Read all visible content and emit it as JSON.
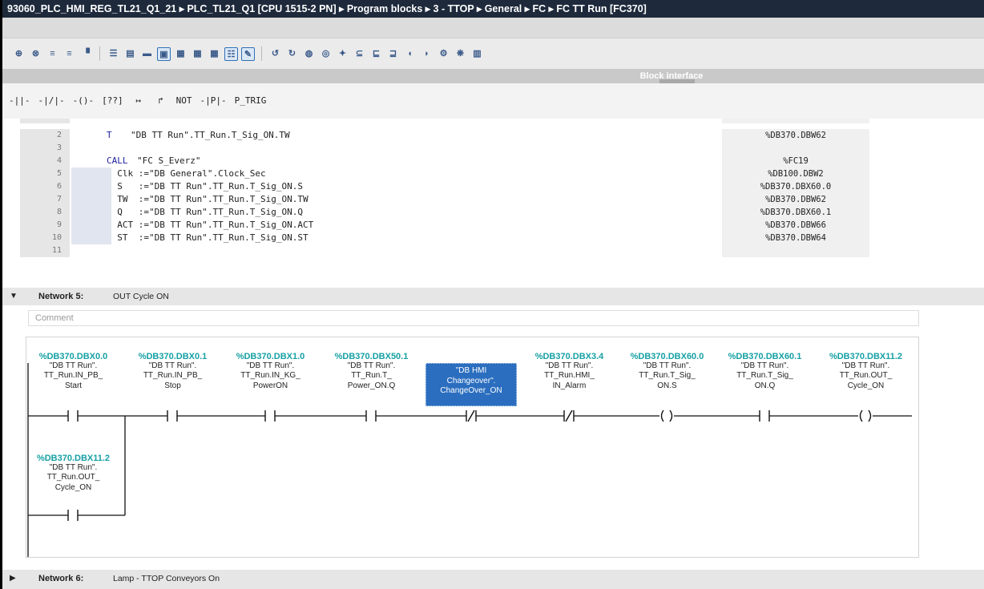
{
  "window": {
    "title": "93060_PLC_HMI_REG_TL21_Q1_21 ▸ PLC_TL21_Q1 [CPU 1515-2 PN] ▸ Program blocks ▸ 3 - TTOP ▸ General ▸ FC ▸ FC TT Run [FC370]"
  },
  "block_interface": {
    "label": "Block interface"
  },
  "lad_toolbar": [
    "-||-",
    "-|/|-",
    "-()-",
    "[??]",
    "↦",
    "↱",
    "NOT",
    "-|P|-",
    "P_TRIG"
  ],
  "stl": {
    "lines": [
      {
        "num": "2",
        "op": "T",
        "code": "\"DB TT Run\".TT_Run.T_Sig_ON.TW",
        "addr": "%DB370.DBW62",
        "hl": false
      },
      {
        "num": "3",
        "op": "",
        "code": "",
        "addr": "",
        "hl": false
      },
      {
        "num": "4",
        "op": "CALL",
        "code": "\"FC S_Everz\"",
        "addr": "%FC19",
        "hl": false
      },
      {
        "num": "5",
        "op": "",
        "code": "  Clk :=\"DB General\".Clock_Sec",
        "addr": "%DB100.DBW2",
        "hl": true
      },
      {
        "num": "6",
        "op": "",
        "code": "  S   :=\"DB TT Run\".TT_Run.T_Sig_ON.S",
        "addr": "%DB370.DBX60.0",
        "hl": true
      },
      {
        "num": "7",
        "op": "",
        "code": "  TW  :=\"DB TT Run\".TT_Run.T_Sig_ON.TW",
        "addr": "%DB370.DBW62",
        "hl": true
      },
      {
        "num": "8",
        "op": "",
        "code": "  Q   :=\"DB TT Run\".TT_Run.T_Sig_ON.Q",
        "addr": "%DB370.DBX60.1",
        "hl": true
      },
      {
        "num": "9",
        "op": "",
        "code": "  ACT :=\"DB TT Run\".TT_Run.T_Sig_ON.ACT",
        "addr": "%DB370.DBW66",
        "hl": true
      },
      {
        "num": "10",
        "op": "",
        "code": "  ST  :=\"DB TT Run\".TT_Run.T_Sig_ON.ST",
        "addr": "%DB370.DBW64",
        "hl": true
      },
      {
        "num": "11",
        "op": "",
        "code": "",
        "addr": "",
        "hl": false
      }
    ]
  },
  "network5": {
    "label": "Network 5:",
    "title": "OUT Cycle ON",
    "comment_placeholder": "Comment",
    "contacts": [
      {
        "addr": "%DB370.DBX0.0",
        "l1": "\"DB TT Run\".",
        "l2": "TT_Run.IN_PB_",
        "l3": "Start",
        "type": "NO"
      },
      {
        "addr": "%DB370.DBX0.1",
        "l1": "\"DB TT Run\".",
        "l2": "TT_Run.IN_PB_",
        "l3": "Stop",
        "type": "NO"
      },
      {
        "addr": "%DB370.DBX1.0",
        "l1": "\"DB TT Run\".",
        "l2": "TT_Run.IN_KG_",
        "l3": "PowerON",
        "type": "NO"
      },
      {
        "addr": "%DB370.DBX50.1",
        "l1": "\"DB TT Run\".",
        "l2": "TT_Run.T_",
        "l3": "Power_ON.Q",
        "type": "NO"
      },
      {
        "addr": "",
        "l1": "\"DB HMI",
        "l2": "Changeover\".",
        "l3": "ChangeOver_ON",
        "type": "NC",
        "selected": true
      },
      {
        "addr": "%DB370.DBX3.4",
        "l1": "\"DB TT Run\".",
        "l2": "TT_Run.HMI_",
        "l3": "IN_Alarm",
        "type": "NC"
      },
      {
        "addr": "%DB370.DBX60.0",
        "l1": "\"DB TT Run\".",
        "l2": "TT_Run.T_Sig_",
        "l3": "ON.S",
        "type": "COIL"
      },
      {
        "addr": "%DB370.DBX60.1",
        "l1": "\"DB TT Run\".",
        "l2": "TT_Run.T_Sig_",
        "l3": "ON.Q",
        "type": "NO"
      },
      {
        "addr": "%DB370.DBX11.2",
        "l1": "\"DB TT Run\".",
        "l2": "TT_Run.OUT_",
        "l3": "Cycle_ON",
        "type": "COIL"
      }
    ],
    "branch": {
      "addr": "%DB370.DBX11.2",
      "l1": "\"DB TT Run\".",
      "l2": "TT_Run.OUT_",
      "l3": "Cycle_ON"
    }
  },
  "network6": {
    "label": "Network 6:",
    "title": "Lamp - TTOP Conveyors On"
  }
}
